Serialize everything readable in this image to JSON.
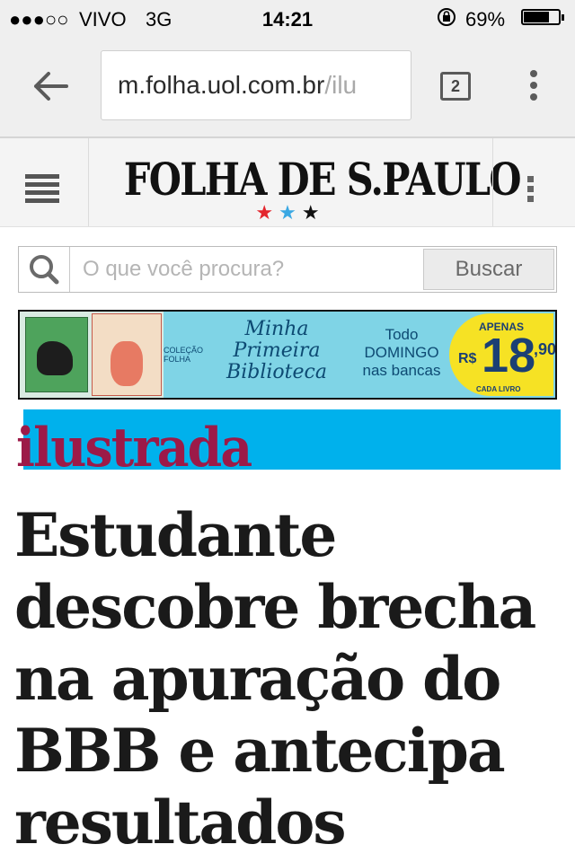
{
  "status_bar": {
    "signal": "●●●○○",
    "carrier": "VIVO",
    "network": "3G",
    "time": "14:21",
    "battery_percent": "69%",
    "battery_level": 0.69,
    "icons": [
      "signal-dots-icon",
      "rotation-lock-icon",
      "battery-icon"
    ]
  },
  "browser": {
    "url_host": "m.folha.uol.com.br",
    "url_rest": "/ilu",
    "tab_count": "2",
    "icons": [
      "back-arrow-icon",
      "tabs-icon",
      "overflow-menu-icon"
    ]
  },
  "site_header": {
    "logo": "FOLHA DE S.PAULO",
    "stars": [
      "★",
      "★",
      "★"
    ],
    "icons": [
      "hamburger-menu-icon",
      "vertical-dots-icon"
    ]
  },
  "search": {
    "placeholder": "O que você procura?",
    "button_label": "Buscar"
  },
  "ad": {
    "tag": "COLEÇÃO FOLHA",
    "title_line1": "Minha",
    "title_line2": "Primeira",
    "title_line3": "Biblioteca",
    "schedule_line1": "Todo",
    "schedule_line2": "DOMINGO",
    "schedule_line3": "nas bancas",
    "price_prefix": "APENAS",
    "currency": "R$",
    "price_amount": "18",
    "price_cents": ",90",
    "price_unit": "CADA LIVRO",
    "colors": {
      "background": "#7fd4e6",
      "price_badge": "#f6e224",
      "text": "#0d4a73"
    }
  },
  "article": {
    "section": "ilustrada",
    "headline": "Estudante descobre brecha na apuração do BBB e antecipa resultados",
    "colors": {
      "section_text": "#9c1a48",
      "section_highlight": "#00b1ec"
    }
  }
}
